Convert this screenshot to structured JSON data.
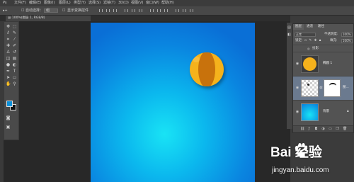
{
  "menubar": {
    "items": [
      "文件(F)",
      "编辑(E)",
      "图像(I)",
      "图层(L)",
      "类型(Y)",
      "选择(S)",
      "滤镜(T)",
      "3D(D)",
      "视图(V)",
      "窗口(W)",
      "帮助(H)"
    ]
  },
  "options_bar": {
    "auto_select_label": "自动选择：",
    "auto_select_value": "组",
    "show_transform_label": "显示变换控件"
  },
  "document": {
    "tab_title": "@ 100%(图层 1, RGB/8)"
  },
  "colors": {
    "foreground": "#0a8fd8",
    "background": "#111111",
    "ball_main": "#f5b21c",
    "ball_stripe": "#c8720c"
  },
  "layers_panel": {
    "tabs": [
      "图层",
      "通道",
      "路径"
    ],
    "blend_mode": "正常",
    "opacity_label": "不透明度:",
    "opacity_value": "100%",
    "lock_label": "锁定:",
    "fill_label": "填充:",
    "fill_value": "100%",
    "effects_label": "投影",
    "layers": [
      {
        "name": "椭圆 1"
      },
      {
        "name": "图..."
      },
      {
        "name": "背景"
      }
    ]
  },
  "watermark": {
    "logo_text": "Bai  经验",
    "url": "jingyan.baidu.com"
  }
}
